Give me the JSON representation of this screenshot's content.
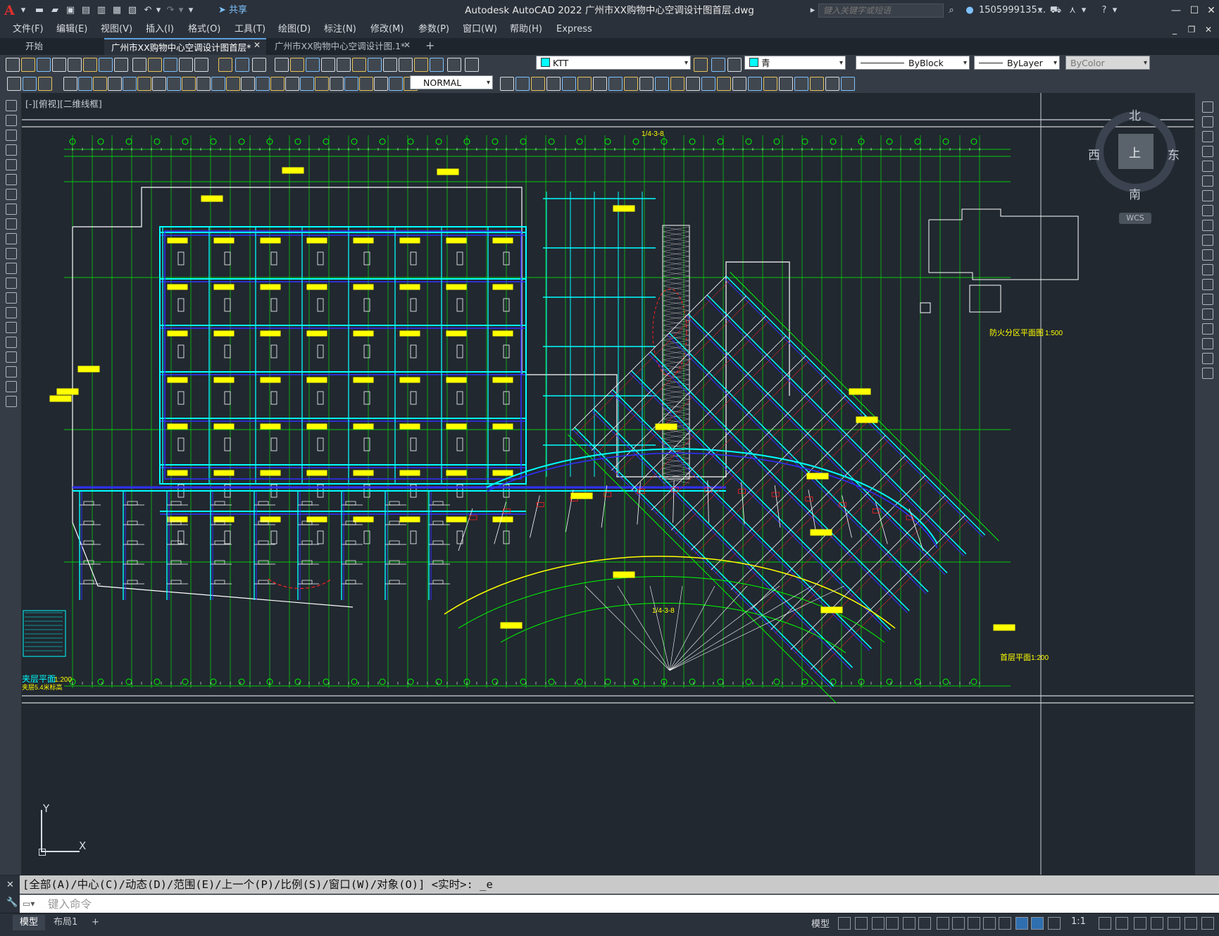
{
  "app": {
    "title": "Autodesk AutoCAD 2022    广州市XX购物中心空调设计图首层.dwg",
    "logo_letter": "A",
    "share_label": "共享",
    "search_placeholder": "键入关键字或短语",
    "user_name": "1505999135...",
    "help_icon": "help-icon"
  },
  "menu": {
    "items": [
      "文件(F)",
      "编辑(E)",
      "视图(V)",
      "插入(I)",
      "格式(O)",
      "工具(T)",
      "绘图(D)",
      "标注(N)",
      "修改(M)",
      "参数(P)",
      "窗口(W)",
      "帮助(H)",
      "Express"
    ]
  },
  "tabs": {
    "start": "开始",
    "active": "广州市XX购物中心空调设计图首层*",
    "second": "广州市XX购物中心空调设计图.1*"
  },
  "toolbar": {
    "layer_value": "KTT",
    "color_value": "青",
    "linetype_value": "ByBlock",
    "lineweight_value": "ByLayer",
    "plotstyle_value": "ByColor",
    "dimstyle_value": "NORMAL"
  },
  "viewport": {
    "label": "[-][俯视][二维线框]"
  },
  "viewcube": {
    "north": "北",
    "south": "南",
    "east": "东",
    "west": "西",
    "top": "上",
    "wcs": "WCS"
  },
  "drawing": {
    "axis_top_label": "1/4-3-8",
    "axis_bottom_label": "1/4-3-8",
    "plan_title_left": "夹层平面",
    "plan_scale_left": "1:200",
    "plan_sub_left": "夹层5.4米标高",
    "plan_title_right": "首层平面",
    "plan_scale_right": "1:200",
    "fire_title": "防火分区平面图",
    "fire_scale": "1:500"
  },
  "ucs": {
    "x": "X",
    "y": "Y"
  },
  "command": {
    "history": "[全部(A)/中心(C)/动态(D)/范围(E)/上一个(P)/比例(S)/窗口(W)/对象(O)] <实时>: _e",
    "placeholder": "键入命令"
  },
  "status": {
    "tab_model": "模型",
    "tab_layout1": "布局1",
    "add_tab": "+",
    "model_label": "模型",
    "scale_label": "1:1"
  },
  "colors": {
    "cyan": "#00ffff",
    "yellow": "#ffff00",
    "green": "#00ff00",
    "blue": "#3030ff",
    "white": "#ffffff",
    "red": "#ff2020",
    "magenta": "#ff00ff"
  }
}
